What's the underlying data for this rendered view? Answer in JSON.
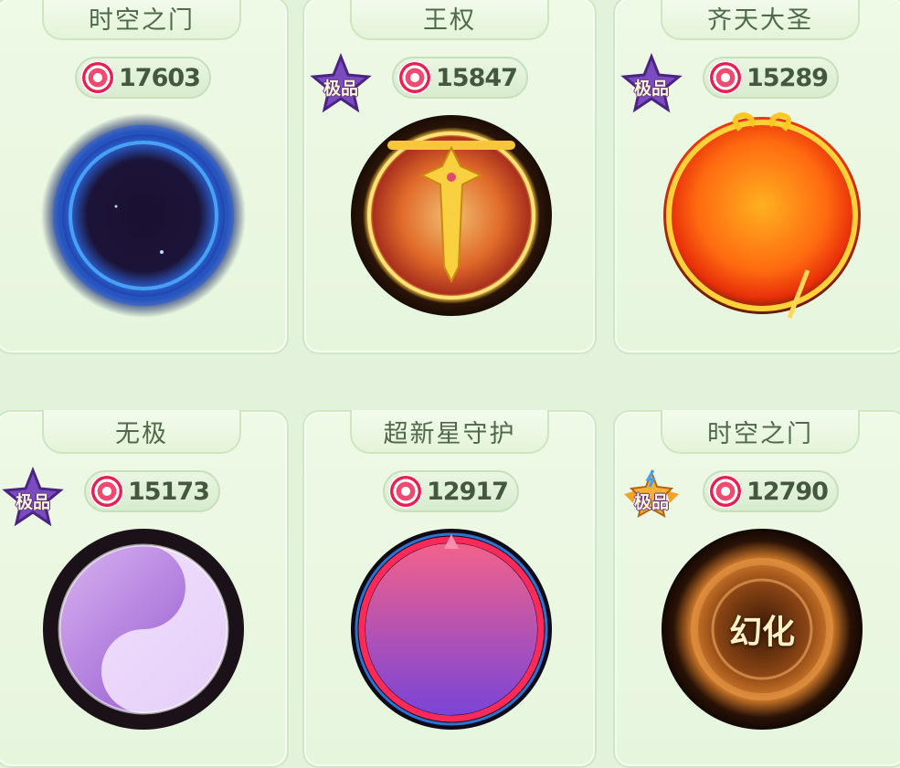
{
  "cells": [
    {
      "title": "时空之门",
      "price": "17603",
      "badge": "",
      "badge_style": "none",
      "frame_style": "portal-blue",
      "frame_label": ""
    },
    {
      "title": "王权",
      "price": "15847",
      "badge": "极品",
      "badge_style": "purple",
      "frame_style": "kingship",
      "frame_label": ""
    },
    {
      "title": "齐天大圣",
      "price": "15289",
      "badge": "极品",
      "badge_style": "purple",
      "frame_style": "monkey-king",
      "frame_label": ""
    },
    {
      "title": "无极",
      "price": "15173",
      "badge": "极品",
      "badge_style": "purple",
      "frame_style": "yin-yang",
      "frame_label": ""
    },
    {
      "title": "超新星守护",
      "price": "12917",
      "badge": "",
      "badge_style": "none",
      "frame_style": "supernova",
      "frame_label": ""
    },
    {
      "title": "时空之门",
      "price": "12790",
      "badge": "极品",
      "badge_style": "gold-wings",
      "frame_style": "portal-gold",
      "frame_label": "幻化"
    }
  ],
  "icons": {
    "price": "candy-currency-icon",
    "badge": "premium-star-badge-icon"
  },
  "colors": {
    "background": "#e3f3db",
    "card": "#eaf7e1",
    "title_text": "#4f6a4a",
    "price_text": "#43583f",
    "candy": "#e8204f",
    "badge_purple": "#6b3fa0",
    "badge_gold": "#f0a020"
  }
}
